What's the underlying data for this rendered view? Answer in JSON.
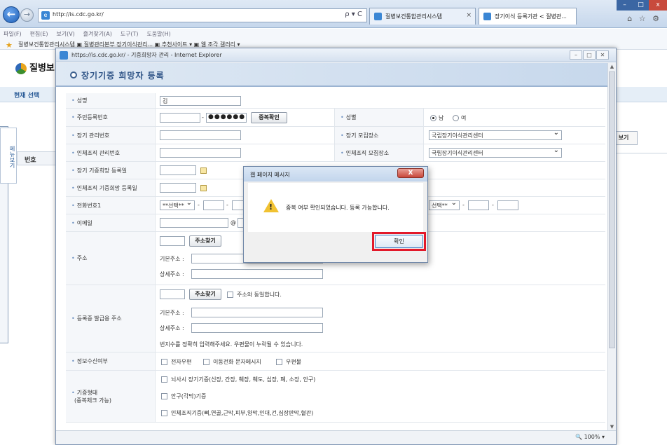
{
  "browser": {
    "address": "http://is.cdc.go.kr/",
    "address_tools": "ρ ▾ C",
    "tabs": [
      {
        "label": "질병보건통합관리시스템"
      },
      {
        "label": "장기이식 등록기관 < 질병관..."
      }
    ],
    "tab_close": "×",
    "window_controls": {
      "minimize": "–",
      "maximize": "□",
      "close": "x"
    },
    "top_right_icons": "⌂ ☆ ⚙",
    "menu": [
      "파일(F)",
      "편집(E)",
      "보기(V)",
      "즐겨찾기(A)",
      "도구(T)",
      "도움말(H)"
    ],
    "favorites_text": "질병보건통합관리시스템  ▣ 질병관리본부 장기이식관리...  ▣ 추천사이트 ▾  ▣ 웹 조각 갤러리 ▾"
  },
  "background_page": {
    "logo_text": "질병보",
    "current_menu": "현재 선택",
    "side_tab": "메뉴보기",
    "table_header_no": "번호",
    "right_button": "보기"
  },
  "popup": {
    "title": "https://is.cdc.go.kr/ - 기증희망자 관리 - Internet Explorer",
    "controls": {
      "minimize": "–",
      "maximize": "□",
      "close": "✕"
    },
    "header": "장기기증 희망자 등록",
    "zoom": "100%",
    "zoom_arrow": "▾"
  },
  "form": {
    "name": {
      "label": "성명",
      "value": "김"
    },
    "rrn": {
      "label": "주민등록번호",
      "dash": "-",
      "masked": "●●●●●●",
      "button": "중복확인"
    },
    "gender": {
      "label": "성별",
      "male": "남",
      "female": "여"
    },
    "organ_mgmt_no": {
      "label": "장기 관리번호"
    },
    "organ_collect_place": {
      "label": "장기 모집장소",
      "value": "국립장기이식관리센터"
    },
    "tissue_mgmt_no": {
      "label": "인체조직 관리번호"
    },
    "tissue_collect_place": {
      "label": "인체조직 모집장소",
      "value": "국립장기이식관리센터"
    },
    "organ_reg_date": {
      "label": "장기 기증희망 등록일"
    },
    "tissue_reg_date": {
      "label": "인체조직 기증희망 등록일"
    },
    "phone1": {
      "label": "전화번호1",
      "select": "**선택**",
      "dash": "-"
    },
    "phone2": {
      "select": "선택**"
    },
    "email": {
      "label": "이메일",
      "at": "@"
    },
    "address": {
      "label": "주소",
      "search_button": "주소찾기",
      "basic": "기본주소 :",
      "detail": "상세주소 :"
    },
    "card_address": {
      "label": "등록증 발급용 주소",
      "search_button": "주소찾기",
      "same": "주소와 동일합니다.",
      "basic": "기본주소 :",
      "detail": "상세주소 :",
      "notice": "번지수를 정확히 입력해주세요. 우편물이 누락될 수 있습니다."
    },
    "info_receive": {
      "label": "정보수신여부",
      "options": [
        "전자우편",
        "이동전화 문자메시지",
        "우편물"
      ]
    },
    "donation_type": {
      "label_line1": "기증형태",
      "label_line2": "(중복체크 가능)",
      "options": [
        "뇌사시 장기기증(신장, 간장, 췌장, 췌도, 심장, 폐, 소장, 안구)",
        "안구(각막)기증",
        "인체조직기증(뼈,연골,근막,피부,양막,인대,건,심장판막,혈관)"
      ]
    }
  },
  "dialog": {
    "title": "웹 페이지 메시지",
    "close": "X",
    "message": "중복 여부 확인되었습니다. 등록 가능합니다.",
    "ok": "확인",
    "warning_mark": "!"
  }
}
